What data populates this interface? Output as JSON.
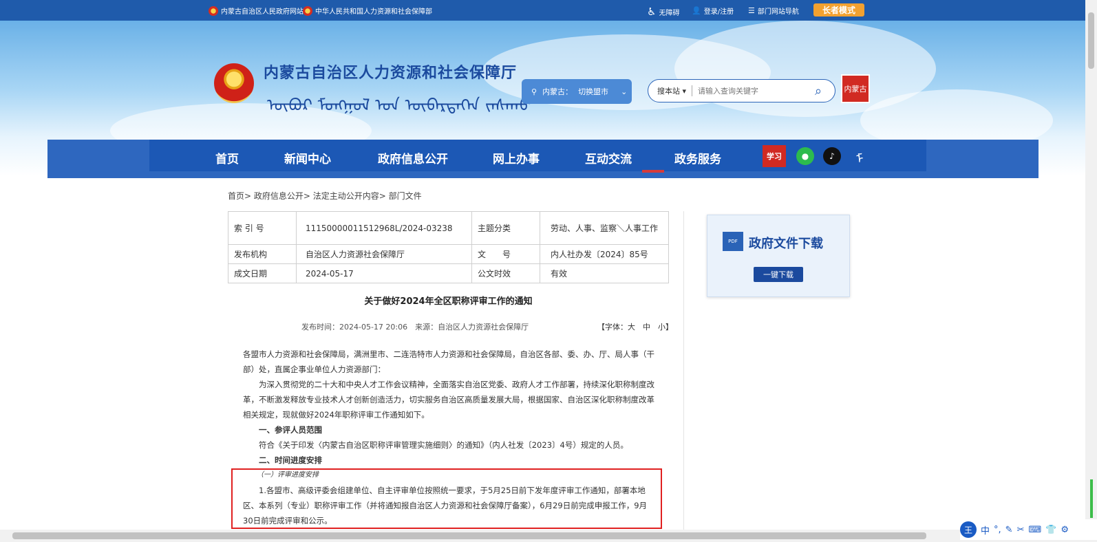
{
  "topbar": {
    "link1": "内蒙古自治区人民政府网站",
    "link2": "中华人民共和国人力资源和社会保障部",
    "accessibility": "无障碍",
    "login": "登录/注册",
    "dept_nav": "部门网站导航",
    "elder_mode": "长者模式"
  },
  "header": {
    "title": "内蒙古自治区人力资源和社会保障厅",
    "mongolian_title": "ᠥᠪᠦᠷ ᠮᠣᠩᠭᠣᠯ ᠤᠨ ᠥᠪᠡᠷᠲᠡᠭᠡᠨ ᠵᠠᠰᠠᠬᠤ",
    "region_label": "内蒙古：",
    "region_action": "切换盟市",
    "search_scope": "搜本站",
    "search_placeholder": "请输入查询关键字",
    "seal_text": "内蒙古"
  },
  "nav": {
    "items": [
      "首页",
      "新闻中心",
      "政府信息公开",
      "网上办事",
      "互动交流",
      "政务服务"
    ],
    "active_index": 4,
    "social": [
      {
        "name": "study-icon",
        "glyph": "学习",
        "color": "#d12a22"
      },
      {
        "name": "wechat-icon",
        "glyph": "●",
        "color": "#2dbb4e"
      },
      {
        "name": "tiktok-icon",
        "glyph": "♪",
        "color": "#111111"
      },
      {
        "name": "mongolian-script-icon",
        "glyph": "ᠮ",
        "color": "#ffffff"
      }
    ]
  },
  "breadcrumb": "首页> 政府信息公开> 法定主动公开内容> 部门文件",
  "meta": {
    "rows": [
      [
        "索 引 号",
        "11150000011512968L/2024-03238",
        "主题分类",
        "劳动、人事、监察＼人事工作"
      ],
      [
        "发布机构",
        "自治区人力资源社会保障厅",
        "文　　号",
        "内人社办发〔2024〕85号"
      ],
      [
        "成文日期",
        "2024-05-17",
        "公文时效",
        "有效"
      ]
    ]
  },
  "article": {
    "title": "关于做好2024年全区职称评审工作的通知",
    "pub_info": "发布时间：2024-05-17 20:06　来源：自治区人力资源社会保障厅",
    "font_size_label": "【字体：大　中　小】",
    "paragraphs": [
      "各盟市人力资源和社会保障局，满洲里市、二连浩特市人力资源和社会保障局，自治区各部、委、办、厅、局人事（干部）处，直属企事业单位人力资源部门：",
      "为深入贯彻党的二十大和中央人才工作会议精神，全面落实自治区党委、政府人才工作部署，持续深化职称制度改革，不断激发释放专业技术人才创新创造活力，切实服务自治区高质量发展大局，根据国家、自治区深化职称制度改革相关规定，现就做好2024年职称评审工作通知如下。",
      "一、参评人员范围",
      "符合《关于印发〈内蒙古自治区职称评审管理实施细则〉的通知》（内人社发〔2023〕4号）规定的人员。",
      "二、时间进度安排",
      "（一）评审进度安排",
      "1.各盟市、高级评委会组建单位、自主评审单位按照统一要求，于5月25日前下发年度评审工作通知，部署本地区、本系列（专业）职称评审工作（并将通知报自治区人力资源和社会保障厅备案），6月29日前完成申报工作，9月30日前完成评审和公示。"
    ]
  },
  "download": {
    "title": "政府文件下载",
    "pdf_label": "PDF",
    "button": "一键下载"
  },
  "ime": {
    "items": [
      "王",
      "中",
      "°,",
      "✎",
      "✂",
      "⌨",
      "👕",
      "⚙"
    ]
  }
}
